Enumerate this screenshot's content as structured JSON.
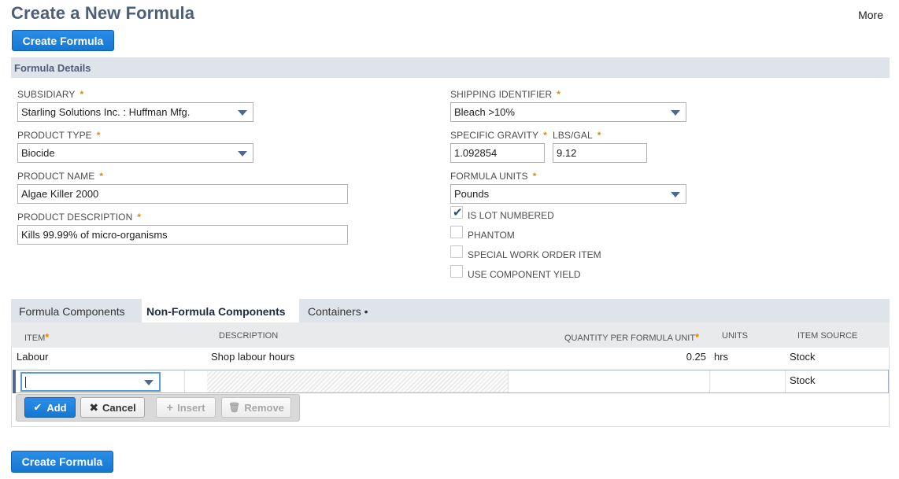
{
  "page": {
    "title": "Create a New Formula",
    "more": "More"
  },
  "actions": {
    "create_formula_top": "Create Formula",
    "create_formula_bottom": "Create Formula"
  },
  "section": {
    "title": "Formula Details"
  },
  "fields": {
    "subsidiary": {
      "label": "SUBSIDIARY",
      "required": "*",
      "value": "Starling Solutions Inc. : Huffman Mfg."
    },
    "product_type": {
      "label": "PRODUCT TYPE",
      "required": "*",
      "value": "Biocide"
    },
    "product_name": {
      "label": "PRODUCT NAME",
      "required": "*",
      "value": "Algae Killer 2000"
    },
    "product_description": {
      "label": "PRODUCT DESCRIPTION",
      "required": "*",
      "value": "Kills 99.99% of micro-organisms"
    },
    "shipping_identifier": {
      "label": "SHIPPING IDENTIFIER",
      "required": "*",
      "value": "Bleach >10%"
    },
    "specific_gravity": {
      "label": "SPECIFIC GRAVITY",
      "required": "*",
      "value": "1.092854"
    },
    "lbs_gal": {
      "label": "LBS/GAL",
      "required": "*",
      "value": "9.12"
    },
    "formula_units": {
      "label": "FORMULA UNITS",
      "required": "*",
      "value": "Pounds"
    }
  },
  "checkboxes": [
    {
      "label": "IS LOT NUMBERED",
      "checked": true
    },
    {
      "label": "PHANTOM",
      "checked": false
    },
    {
      "label": "SPECIAL WORK ORDER ITEM",
      "checked": false
    },
    {
      "label": "USE COMPONENT YIELD",
      "checked": false
    }
  ],
  "tabs": [
    {
      "label": "Formula Components",
      "active": false
    },
    {
      "label": "Non-Formula Components",
      "active": true
    },
    {
      "label": "Containers",
      "suffix": "•",
      "active": false
    }
  ],
  "grid": {
    "columns": {
      "item": "ITEM",
      "item_req": "*",
      "description": "DESCRIPTION",
      "quantity": "QUANTITY PER FORMULA UNIT",
      "quantity_req": "*",
      "units": "UNITS",
      "item_source": "ITEM SOURCE"
    },
    "rows": [
      {
        "item": "Labour",
        "description": "Shop labour hours",
        "quantity": "0.25",
        "units": "hrs",
        "item_source": "Stock"
      }
    ],
    "edit_row": {
      "item_source": "Stock"
    },
    "buttons": {
      "add": "Add",
      "cancel": "Cancel",
      "insert": "Insert",
      "remove": "Remove"
    }
  },
  "colors": {
    "accent": "#1677d2",
    "title": "#4d5f79",
    "section_bg": "#dfe4eb",
    "required": "#e28a00"
  }
}
